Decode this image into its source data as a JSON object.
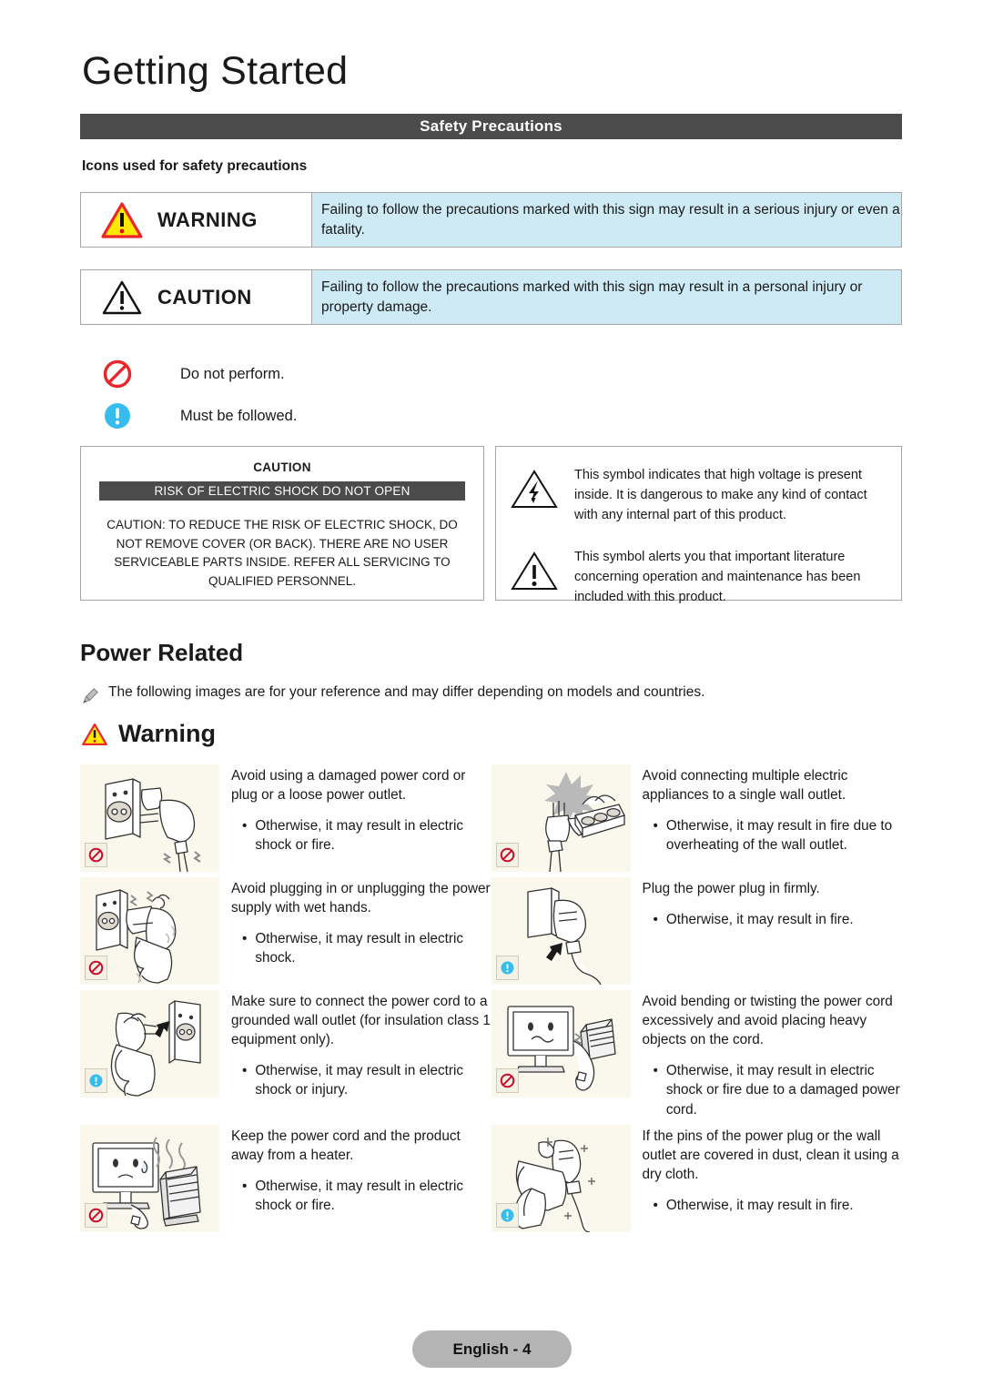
{
  "header": {
    "chapter_title": "Getting Started",
    "section_bar": "Safety Precautions",
    "icons_caption": "Icons used for safety precautions"
  },
  "severity_table": [
    {
      "label": "WARNING",
      "icon": "warning-triangle-yellow-icon",
      "text": "Failing to follow the precautions marked with this sign may result in a serious injury or even a fatality."
    },
    {
      "label": "CAUTION",
      "icon": "caution-triangle-white-icon",
      "text": "Failing to follow the precautions marked with this sign may result in a personal injury or property damage."
    }
  ],
  "icon_legend": [
    {
      "icon": "prohibition-circle-icon",
      "text": "Do not perform."
    },
    {
      "icon": "must-follow-circle-icon",
      "text": "Must be followed."
    }
  ],
  "shock_box": {
    "title": "CAUTION",
    "bar": "RISK OF ELECTRIC SHOCK DO NOT OPEN",
    "body": "CAUTION: TO REDUCE THE RISK OF ELECTRIC SHOCK, DO NOT REMOVE COVER (OR BACK). THERE ARE NO USER SERVICEABLE PARTS INSIDE. REFER ALL SERVICING TO QUALIFIED PERSONNEL."
  },
  "symbol_box": [
    {
      "icon": "lightning-bolt-triangle-icon",
      "text": "This symbol indicates that high voltage is present inside. It is dangerous to make any kind of contact with any internal part of this product."
    },
    {
      "icon": "exclamation-triangle-icon",
      "text": "This symbol alerts you that important literature concerning operation and maintenance has been included with this product."
    }
  ],
  "power_related": {
    "heading": "Power Related",
    "note": "The following images are for your reference and may differ depending on models and countries.",
    "warning_heading": "Warning"
  },
  "warnings": [
    {
      "badge": "prohibition",
      "illustration": "damaged-plug-and-outlet-illustration",
      "lead": "Avoid using a damaged power cord or plug or a loose power outlet.",
      "bullet": "Otherwise, it may result in electric shock or fire."
    },
    {
      "badge": "prohibition",
      "illustration": "overloaded-power-strip-illustration",
      "lead": "Avoid connecting multiple electric appliances to a single wall outlet.",
      "bullet": "Otherwise, it may result in fire due to overheating of the wall outlet."
    },
    {
      "badge": "prohibition",
      "illustration": "wet-hands-plug-illustration",
      "lead": "Avoid plugging in or unplugging the power supply with wet hands.",
      "bullet": "Otherwise, it may result in electric shock."
    },
    {
      "badge": "must-follow",
      "illustration": "plug-firmly-inserted-illustration",
      "lead": "Plug the power plug in firmly.",
      "bullet": "Otherwise, it may result in fire."
    },
    {
      "badge": "must-follow",
      "illustration": "grounded-wall-outlet-illustration",
      "lead": "Make sure to connect the power cord to a grounded wall outlet (for insulation class 1 equipment only).",
      "bullet": "Otherwise, it may result in electric shock or injury."
    },
    {
      "badge": "prohibition",
      "illustration": "bent-cord-heavy-object-illustration",
      "lead": "Avoid bending or twisting the power cord excessively and avoid placing heavy objects on the cord.",
      "bullet": "Otherwise, it may result in electric shock or fire due to a damaged power cord."
    },
    {
      "badge": "prohibition",
      "illustration": "monitor-near-heater-illustration",
      "lead": "Keep the power cord and the product away from a heater.",
      "bullet": "Otherwise, it may result in electric shock or fire."
    },
    {
      "badge": "must-follow",
      "illustration": "clean-plug-with-dry-cloth-illustration",
      "lead": "If the pins of the power plug or the wall outlet are covered in dust, clean it using a dry cloth.",
      "bullet": "Otherwise, it may result in fire."
    }
  ],
  "bullet_char": "•",
  "footer": {
    "page_label": "English - 4"
  },
  "colors": {
    "bar_dark": "#4b4b4b",
    "info_blue": "#ceeaf5",
    "thumb_cream": "#faf8ec",
    "warning_yellow": "#ffe800",
    "warning_red": "#e8262c",
    "must_blue": "#36bdee",
    "footer_gray": "#b4b4b4"
  }
}
